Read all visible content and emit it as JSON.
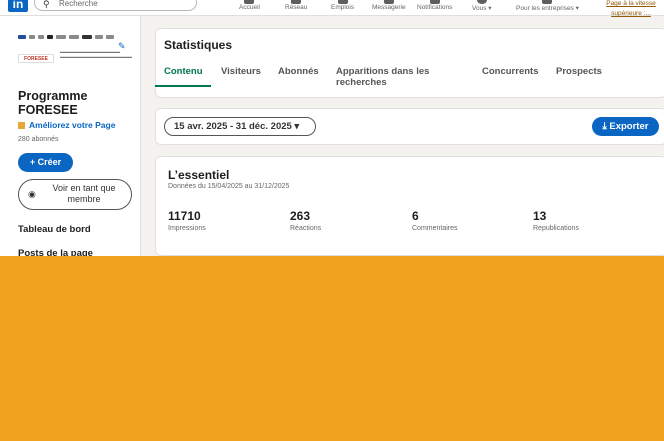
{
  "nav": {
    "logo_text": "in",
    "search_placeholder": "Recherche",
    "items": [
      {
        "label": "Accueil",
        "icon": "home-icon"
      },
      {
        "label": "Réseau",
        "icon": "network-icon"
      },
      {
        "label": "Emplois",
        "icon": "jobs-icon"
      },
      {
        "label": "Messagerie",
        "icon": "messaging-icon"
      },
      {
        "label": "Notifications",
        "icon": "bell-icon"
      },
      {
        "label": "Vous ▾",
        "icon": "avatar-icon"
      },
      {
        "label": "Pour les entreprises ▾",
        "icon": "grid-icon"
      }
    ],
    "premium_line1": "Page à la vitesse",
    "premium_line2": "supérieure :..."
  },
  "sidebar": {
    "org_logo_text": "FORESEE",
    "org_name": "Programme FORESEE",
    "improve_link": "Améliorez votre Page",
    "followers": "280 abonnés",
    "create_button": "+ Créer",
    "member_button": "Voir en tant que membre",
    "links": [
      "Tableau de bord",
      "Posts de la page"
    ]
  },
  "main": {
    "title": "Statistiques",
    "tabs": [
      "Contenu",
      "Visiteurs",
      "Abonnés",
      "Apparitions dans les recherches",
      "Concurrents",
      "Prospects"
    ],
    "active_tab": "Contenu",
    "date_range": "15 avr. 2025 - 31 déc. 2025 ▾",
    "export_button": "⤓ Exporter",
    "essentiel": {
      "title": "L’essentiel",
      "subtitle": "Données du 15/04/2025 au 31/12/2025",
      "metrics": [
        {
          "value": "11710",
          "label": "Impressions"
        },
        {
          "value": "263",
          "label": "Réactions"
        },
        {
          "value": "6",
          "label": "Commentaires"
        },
        {
          "value": "13",
          "label": "Republications"
        }
      ]
    }
  },
  "colors": {
    "background": "#f0a21e",
    "brand_blue": "#0a66c2",
    "active_tab_green": "#01754f"
  }
}
